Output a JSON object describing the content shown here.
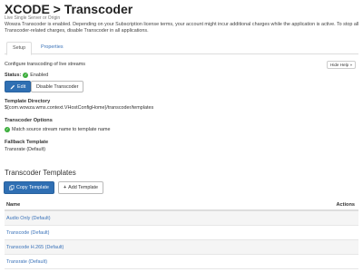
{
  "header": {
    "title": "XCODE > Transcoder",
    "subtitle": "Live Single Server or Origin",
    "notice": "Wowza Transcoder is enabled. Depending on your Subscription license terms, your account might incur additional charges while the application is active. To stop all Transcoder-related charges, disable Transcoder in all applications."
  },
  "tabs": [
    {
      "label": "Setup",
      "active": true
    },
    {
      "label": "Properties",
      "active": false
    }
  ],
  "setup": {
    "configure_text": "Configure transcoding of live streams",
    "hide_help_label": "Hide Help »",
    "status_label": "Status:",
    "status_value": "Enabled",
    "status_color": "#3cae3c",
    "edit_label": "Edit",
    "disable_label": "Disable Transcoder",
    "template_directory_label": "Template Directory",
    "template_directory_value": "${com.wowza.wms.context.VHostConfigHome}/transcoder/templates",
    "options_label": "Transcoder Options",
    "options_value": "Match source stream name to template name",
    "fallback_label": "Fallback Template",
    "fallback_value": "Transrate (Default)"
  },
  "templates": {
    "heading": "Transcoder Templates",
    "copy_label": "Copy Template",
    "add_label": "Add Template",
    "columns": {
      "name": "Name",
      "actions": "Actions"
    },
    "rows": [
      {
        "name": "Audio Only (Default)"
      },
      {
        "name": "Transcode (Default)"
      },
      {
        "name": "Transcode H.265 (Default)"
      },
      {
        "name": "Transrate (Default)"
      }
    ]
  },
  "colors": {
    "accent": "#2f6fb3",
    "link": "#3b73b9",
    "success": "#3cae3c"
  }
}
